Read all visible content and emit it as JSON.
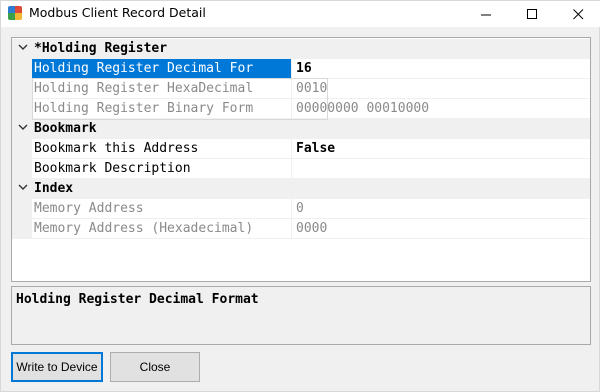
{
  "window": {
    "title": "Modbus Client Record Detail",
    "icon": "modbus-app-icon",
    "controls": {
      "minimize": "minimize-icon",
      "maximize": "maximize-icon",
      "close": "close-icon"
    }
  },
  "grid": {
    "categories": [
      {
        "label": "*Holding Register",
        "properties": [
          {
            "name": "Holding Register Decimal For",
            "value": "16",
            "selected": true
          },
          {
            "name": "Holding Register HexaDecimal",
            "value": "0010"
          },
          {
            "name": "Holding Register Binary Form",
            "value": "00000000 00010000"
          }
        ]
      },
      {
        "label": "Bookmark",
        "properties": [
          {
            "name": "Bookmark this Address",
            "value": "False"
          },
          {
            "name": "Bookmark Description",
            "value": ""
          }
        ]
      },
      {
        "label": "Index",
        "properties": [
          {
            "name": "Memory Address",
            "value": "0"
          },
          {
            "name": "Memory Address (Hexadecimal)",
            "value": "0000"
          }
        ]
      }
    ]
  },
  "description": {
    "title": "Holding Register Decimal Format"
  },
  "buttons": {
    "write": "Write to Device",
    "close": "Close"
  },
  "colors": {
    "selection": "#0078d7",
    "category_bg": "#f0f0f0",
    "readonly_text": "#8a8a8a"
  }
}
